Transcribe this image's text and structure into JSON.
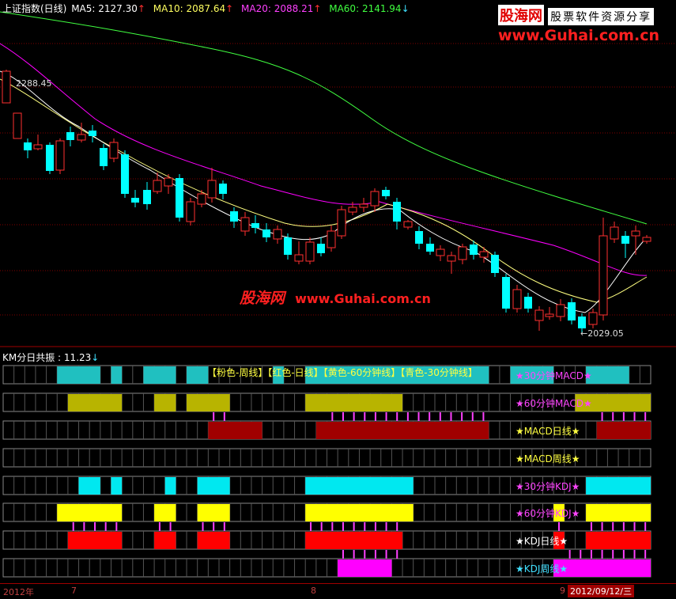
{
  "header": {
    "title": "上证指数(日线)",
    "ma5_label": "MA5:",
    "ma5_value": "2127.30",
    "ma5_arrow": "↑",
    "ma10_label": "MA10:",
    "ma10_value": "2087.64",
    "ma10_arrow": "↑",
    "ma20_label": "MA20:",
    "ma20_value": "2088.21",
    "ma20_arrow": "↑",
    "ma60_label": "MA60:",
    "ma60_value": "2141.94",
    "ma60_arrow": "↓"
  },
  "logo": {
    "name": "股海网",
    "slogan": "股票软件资源分享",
    "url": "www.Guhai.com.cn"
  },
  "watermark": {
    "name": "股海网",
    "url": "www.Guhai.com.cn"
  },
  "price_labels": {
    "high": "2288.45",
    "low": "←2029.05"
  },
  "indicator": {
    "title": "KM分日共振 :",
    "value": "11.23",
    "arrow": "↓"
  },
  "legend": [
    "【粉色-周线】",
    "【红色-日线】",
    "【黄色-60分钟线】",
    "【青色-30分钟线】"
  ],
  "rows": [
    {
      "label": "★30分钟MACD★",
      "label_color": "#ff44ff",
      "color": "#20c0c0"
    },
    {
      "label": "★60分钟MACD★",
      "label_color": "#ff44ff",
      "color": "#b8b400"
    },
    {
      "label": "★MACD日线★",
      "label_color": "#ffff40",
      "color": "#a00000"
    },
    {
      "label": "★MACD周线★",
      "label_color": "#ffff40",
      "color": "#ff00ff"
    },
    {
      "label": "★30分钟KDJ★",
      "label_color": "#ff44ff",
      "color": "#00e8f0"
    },
    {
      "label": "★60分钟KDJ★",
      "label_color": "#ff44ff",
      "color": "#ffff00"
    },
    {
      "label": "★KDJ日线★",
      "label_color": "#ffffff",
      "color": "#ff0000"
    },
    {
      "label": "★KDJ周线★",
      "label_color": "#40e0ff",
      "color": "#ff00ff"
    }
  ],
  "bottom_axis": {
    "year": "2012年",
    "m7": "7",
    "m8": "8",
    "m9": "9",
    "date": "2012/09/12/三"
  },
  "colors": {
    "up": "#ff3030",
    "down": "#00ffff",
    "ma5": "#ffffff",
    "ma10": "#ffff80",
    "ma20": "#ff00ff",
    "ma60": "#40ff40",
    "grid": "#800000"
  },
  "chart_data": {
    "type": "candlestick",
    "title": "上证指数(日线)",
    "x": [
      "2012年",
      "7",
      "8",
      "9"
    ],
    "y_range": [
      2029.05,
      2288.45
    ],
    "series": [
      {
        "name": "MA5",
        "last": 2127.3
      },
      {
        "name": "MA10",
        "last": 2087.64
      },
      {
        "name": "MA20",
        "last": 2088.21
      },
      {
        "name": "MA60",
        "last": 2141.94
      }
    ],
    "high": 2288.45,
    "low": 2029.05
  }
}
